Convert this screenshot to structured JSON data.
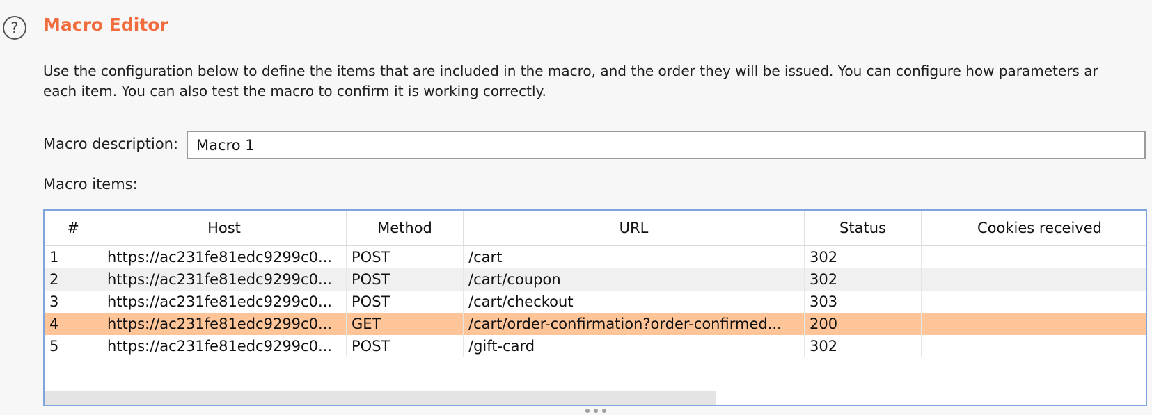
{
  "header": {
    "help_icon_glyph": "?",
    "title": "Macro Editor",
    "title_color": "#f26d3d"
  },
  "description": {
    "line1": "Use the configuration below to define the items that are included in the macro, and the order they will be issued. You can configure how parameters ar",
    "line2": "each item. You can also test the macro to confirm it is working correctly."
  },
  "macro_description": {
    "label": "Macro description:",
    "value": "Macro 1"
  },
  "macro_items": {
    "label": "Macro items:",
    "columns": [
      "#",
      "Host",
      "Method",
      "URL",
      "Status",
      "Cookies received"
    ],
    "rows": [
      {
        "num": "1",
        "host": "https://ac231fe81edc9299c0...",
        "method": "POST",
        "url": "/cart",
        "status": "302",
        "cookies": "",
        "selected": false
      },
      {
        "num": "2",
        "host": "https://ac231fe81edc9299c0...",
        "method": "POST",
        "url": "/cart/coupon",
        "status": "302",
        "cookies": "",
        "selected": false
      },
      {
        "num": "3",
        "host": "https://ac231fe81edc9299c0...",
        "method": "POST",
        "url": "/cart/checkout",
        "status": "303",
        "cookies": "",
        "selected": false
      },
      {
        "num": "4",
        "host": "https://ac231fe81edc9299c0...",
        "method": "GET",
        "url": "/cart/order-confirmation?order-confirmed...",
        "status": "200",
        "cookies": "",
        "selected": true
      },
      {
        "num": "5",
        "host": "https://ac231fe81edc9299c0...",
        "method": "POST",
        "url": "/gift-card",
        "status": "302",
        "cookies": "",
        "selected": false
      }
    ],
    "selected_row_color": "#ffc497",
    "border_color": "#7fa6dc"
  },
  "icons": {
    "help": "help-icon",
    "resize_grip": "drag-handle-icon"
  }
}
